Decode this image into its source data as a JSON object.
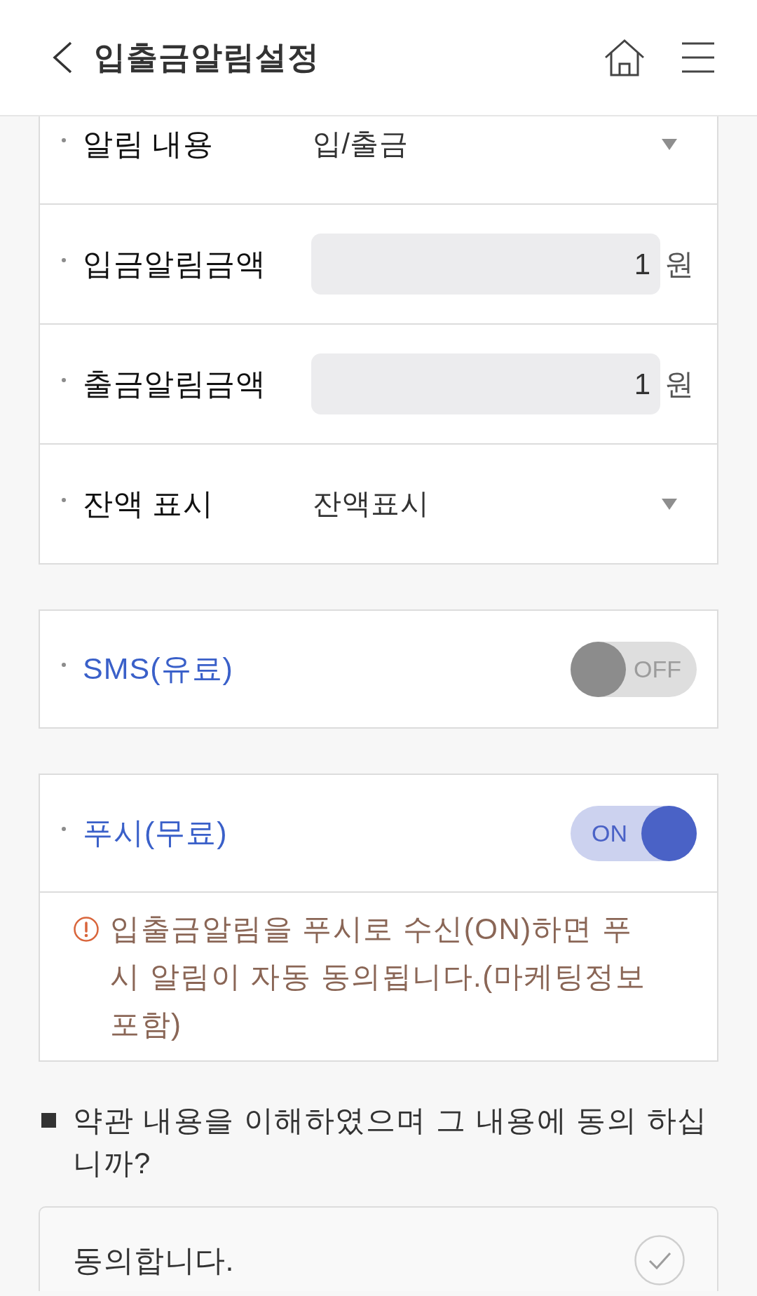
{
  "header": {
    "title": "입출금알림설정"
  },
  "settings": [
    {
      "kind": "select",
      "label": "알림 내용",
      "value": "입/출금"
    },
    {
      "kind": "amount",
      "label": "입금알림금액",
      "value": "1",
      "unit": "원"
    },
    {
      "kind": "amount",
      "label": "출금알림금액",
      "value": "1",
      "unit": "원"
    },
    {
      "kind": "select",
      "label": "잔액 표시",
      "value": "잔액표시"
    }
  ],
  "channels": [
    {
      "label": "SMS(유료)",
      "on": false,
      "state_text": "OFF"
    },
    {
      "label": "푸시(무료)",
      "on": true,
      "state_text": "ON",
      "notice": "입출금알림을 푸시로 수신(ON)하면 푸시 알림이 자동 동의됩니다.(마케팅정보 포함)"
    }
  ],
  "terms": {
    "question": "약관 내용을 이해하였으며 그 내용에 동의 하십니까?",
    "agree": {
      "label": "동의합니다.",
      "checked": false
    }
  }
}
